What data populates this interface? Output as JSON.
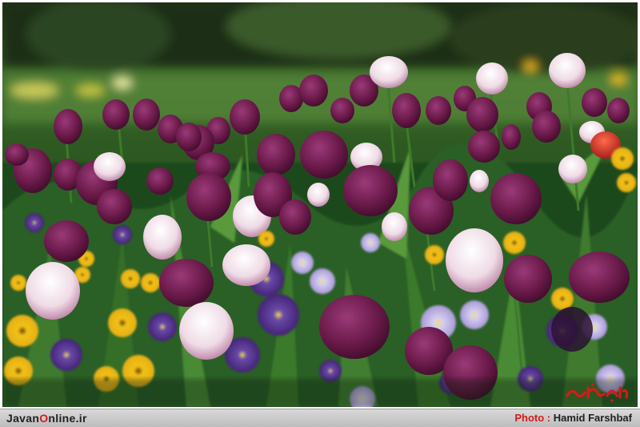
{
  "image": {
    "subject": "tulip-garden",
    "colors": {
      "tulip_purple": "#6b1a4a",
      "tulip_white": "#f2e6ee",
      "tulip_red": "#c02020",
      "foliage": "#2f6a2a",
      "pansy_yellow": "#f2c21a",
      "pansy_violet": "#4a2a7a",
      "background_green": "#3f6a2a"
    }
  },
  "footer": {
    "site_prefix": "Javan",
    "site_highlight": "O",
    "site_suffix": "nline.ir",
    "photo_label": "Photo :",
    "photographer": "Hamid Farshbaf"
  },
  "watermark": {
    "icon": "javan-logo-watermark",
    "color": "#d61a1a"
  }
}
